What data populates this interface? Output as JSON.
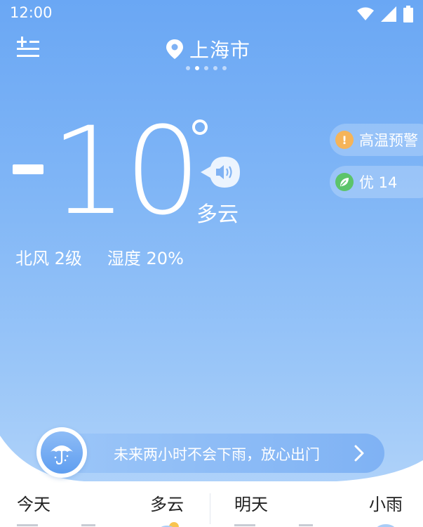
{
  "status_bar": {
    "time": "12:00",
    "icons": [
      "wifi-icon",
      "cell-signal-icon",
      "battery-icon"
    ]
  },
  "header": {
    "location": "上海市",
    "page_count": 5,
    "active_page": 1
  },
  "current": {
    "temperature": "-10",
    "condition": "多云",
    "wind": "北风 2级",
    "humidity": "湿度 20%"
  },
  "chips": {
    "alert": {
      "icon": "!",
      "label": "高温预警"
    },
    "aqi": {
      "label": "优 14"
    }
  },
  "rain_banner": {
    "text": "未来两小时不会下雨，放心出门"
  },
  "forecast": {
    "today_label": "今天",
    "today_condition": "多云",
    "tomorrow_label": "明天",
    "tomorrow_condition": "小雨"
  },
  "colors": {
    "sky_top": "#6aa7f4",
    "sky_bottom": "#b6d6fa",
    "alert_orange": "#f5b45a",
    "aqi_green": "#5cc46a"
  }
}
